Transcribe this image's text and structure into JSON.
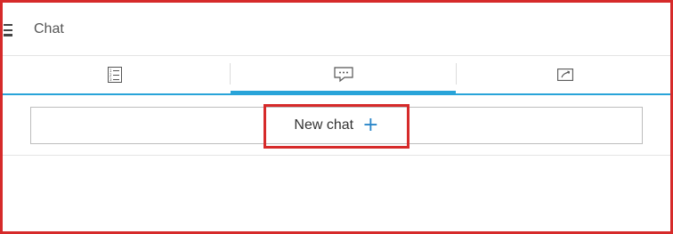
{
  "header": {
    "title": "Chat",
    "menu_icon": "hamburger-icon"
  },
  "tabs": [
    {
      "icon": "list-icon",
      "active": false
    },
    {
      "icon": "chat-bubble-icon",
      "active": true
    },
    {
      "icon": "phone-icon",
      "active": false
    }
  ],
  "new_chat": {
    "label": "New chat",
    "icon": "plus-icon",
    "plus_symbol": "+"
  },
  "colors": {
    "accent": "#29a4d9",
    "highlight": "#d62a2a",
    "plus": "#2a86c9"
  }
}
